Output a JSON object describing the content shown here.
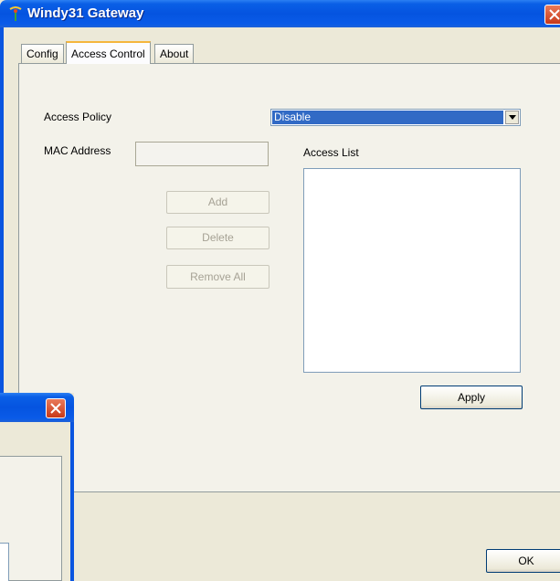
{
  "window": {
    "title": "Windy31 Gateway",
    "accent": "#0a5fe6"
  },
  "tabs": [
    {
      "label": "Config",
      "active": false
    },
    {
      "label": "Access Control",
      "active": true
    },
    {
      "label": "About",
      "active": false
    }
  ],
  "access_control": {
    "access_policy_label": "Access Policy",
    "access_policy_value": "Disable",
    "mac_address_label": "MAC Address",
    "mac_address_value": "",
    "access_list_label": "Access List",
    "access_list_items": [],
    "add_label": "Add",
    "delete_label": "Delete",
    "remove_all_label": "Remove All",
    "apply_label": "Apply"
  },
  "footer": {
    "ok_label": "OK"
  }
}
